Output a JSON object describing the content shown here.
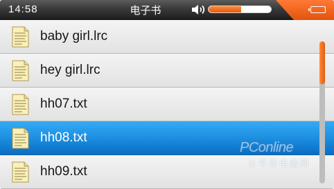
{
  "status_bar": {
    "time": "14:58",
    "title": "电子书",
    "volume_level": 0.52,
    "icons": [
      "speaker-icon",
      "battery-icon"
    ],
    "accent_color": "#f26a21"
  },
  "files": [
    {
      "name": "baby girl.lrc",
      "icon": "document-icon",
      "selected": false
    },
    {
      "name": "hey girl.lrc",
      "icon": "document-icon",
      "selected": false
    },
    {
      "name": "hh07.txt",
      "icon": "document-icon",
      "selected": false
    },
    {
      "name": "hh08.txt",
      "icon": "document-icon",
      "selected": true
    },
    {
      "name": "hh09.txt",
      "icon": "document-icon",
      "selected": false
    }
  ],
  "scrollbar": {
    "position": 0.0
  },
  "watermark": {
    "logo": "PConline",
    "subtitle": "太平洋电脑网"
  },
  "colors": {
    "selection": "#1d8fe0",
    "scroll_thumb": "#f26a21",
    "status_bar": "#2a2a2a"
  }
}
